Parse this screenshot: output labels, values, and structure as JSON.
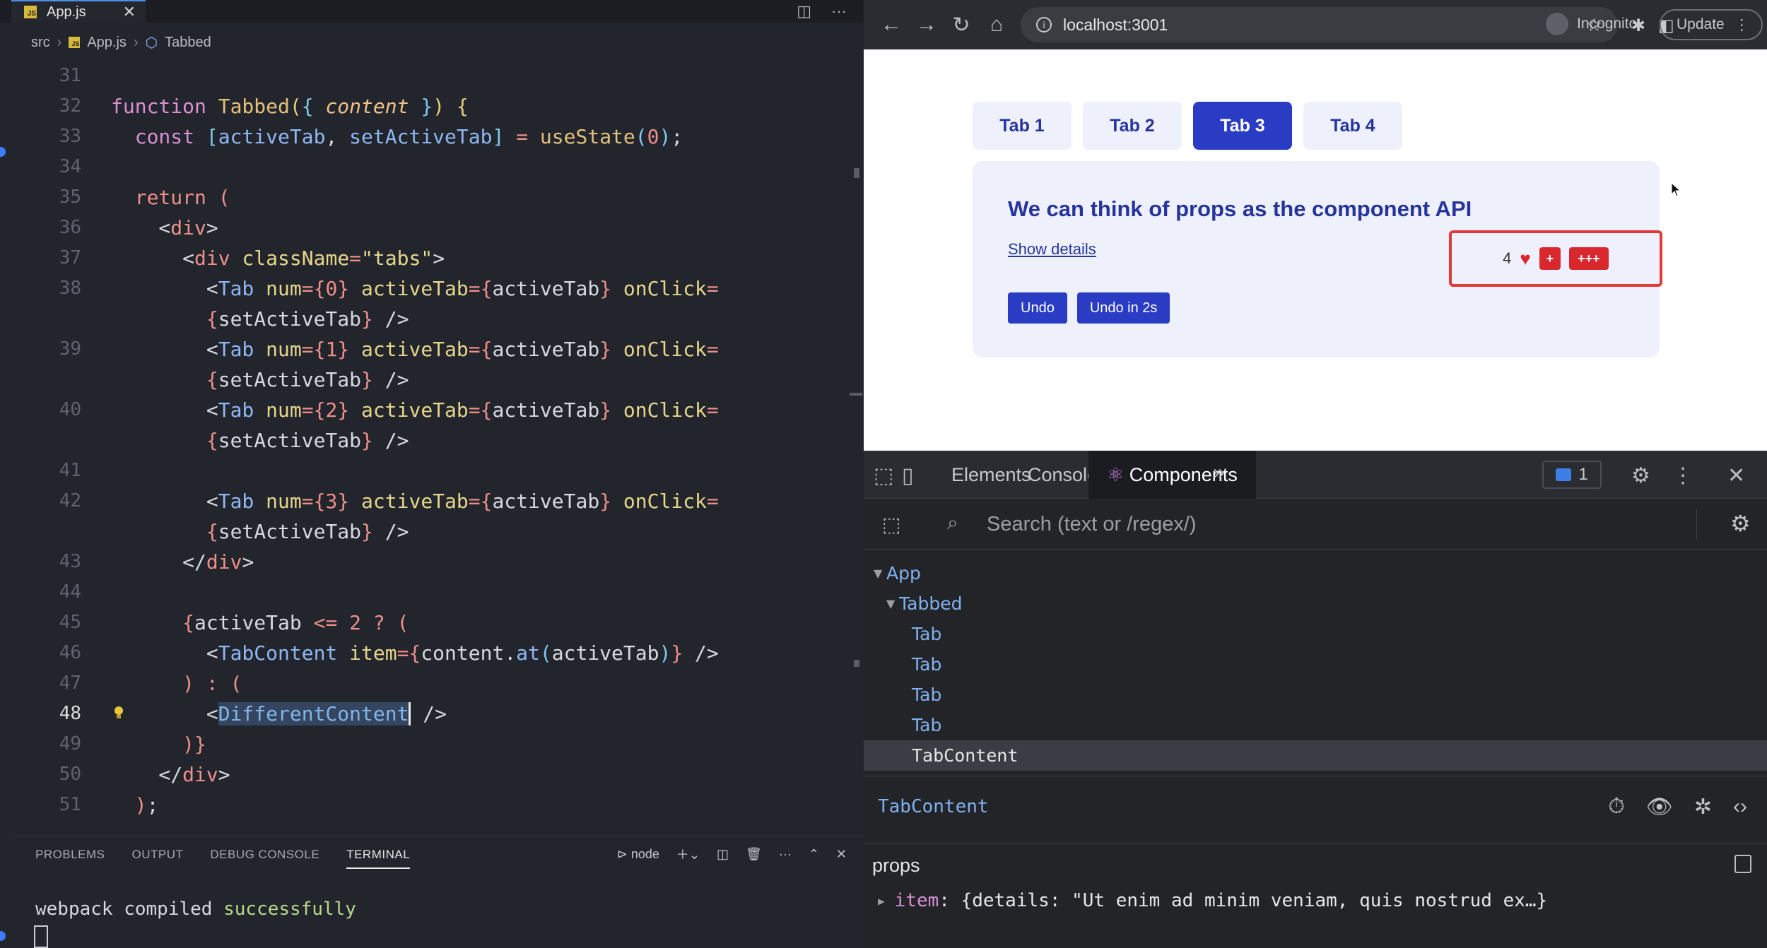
{
  "editor": {
    "tab": {
      "icon": "JS",
      "label": "App.js",
      "close": "✕"
    },
    "tab_actions": {
      "split": "◫",
      "more": "···"
    },
    "breadcrumb": {
      "folder": "src",
      "file": "App.js",
      "symbol": "Tabbed"
    },
    "lines": [
      {
        "n": "31",
        "html": ""
      },
      {
        "n": "32",
        "html": "<span class=\"k\">function</span> <span class=\"fn\">Tabbed</span><span class=\"br\">(</span><span class=\"cm\">{</span> <span class=\"it\">content</span> <span class=\"cm\">}</span><span class=\"br\">)</span> <span class=\"br\">{</span>"
      },
      {
        "n": "33",
        "html": "  <span class=\"k\">const</span> <span class=\"cm\">[</span><span class=\"tag\">activeTab</span>, <span class=\"tag\">setActiveTab</span><span class=\"cm\">]</span> <span class=\"kw\">=</span> <span class=\"fn\">useState</span><span class=\"cm\">(</span><span class=\"num\">0</span><span class=\"cm\">)</span>;"
      },
      {
        "n": "34",
        "html": ""
      },
      {
        "n": "35",
        "html": "  <span class=\"kw\">return</span> <span class=\"kw\">(</span>"
      },
      {
        "n": "36",
        "html": "    &lt;<span class=\"kw\">div</span>&gt;"
      },
      {
        "n": "37",
        "html": "      &lt;<span class=\"kw\">div</span> <span class=\"attr\">className</span><span class=\"kw\">=</span><span class=\"str\">\"tabs\"</span>&gt;"
      },
      {
        "n": "38",
        "html": "        &lt;<span class=\"tag\">Tab</span> <span class=\"attr\">num</span><span class=\"kw\">=</span><span class=\"kw\">{</span><span class=\"num\">0</span><span class=\"kw\">}</span> <span class=\"attr\">activeTab</span><span class=\"kw\">=</span><span class=\"kw\">{</span>activeTab<span class=\"kw\">}</span> <span class=\"attr\">onClick</span><span class=\"kw\">=</span>"
      },
      {
        "n": "",
        "html": "        <span class=\"kw\">{</span>setActiveTab<span class=\"kw\">}</span> /&gt;"
      },
      {
        "n": "39",
        "html": "        &lt;<span class=\"tag\">Tab</span> <span class=\"attr\">num</span><span class=\"kw\">=</span><span class=\"kw\">{</span><span class=\"num\">1</span><span class=\"kw\">}</span> <span class=\"attr\">activeTab</span><span class=\"kw\">=</span><span class=\"kw\">{</span>activeTab<span class=\"kw\">}</span> <span class=\"attr\">onClick</span><span class=\"kw\">=</span>"
      },
      {
        "n": "",
        "html": "        <span class=\"kw\">{</span>setActiveTab<span class=\"kw\">}</span> /&gt;"
      },
      {
        "n": "40",
        "html": "        &lt;<span class=\"tag\">Tab</span> <span class=\"attr\">num</span><span class=\"kw\">=</span><span class=\"kw\">{</span><span class=\"num\">2</span><span class=\"kw\">}</span> <span class=\"attr\">activeTab</span><span class=\"kw\">=</span><span class=\"kw\">{</span>activeTab<span class=\"kw\">}</span> <span class=\"attr\">onClick</span><span class=\"kw\">=</span>"
      },
      {
        "n": "",
        "html": "        <span class=\"kw\">{</span>setActiveTab<span class=\"kw\">}</span> /&gt;"
      },
      {
        "n": "41",
        "html": ""
      },
      {
        "n": "42",
        "html": "        &lt;<span class=\"tag\">Tab</span> <span class=\"attr\">num</span><span class=\"kw\">=</span><span class=\"kw\">{</span><span class=\"num\">3</span><span class=\"kw\">}</span> <span class=\"attr\">activeTab</span><span class=\"kw\">=</span><span class=\"kw\">{</span>activeTab<span class=\"kw\">}</span> <span class=\"attr\">onClick</span><span class=\"kw\">=</span>"
      },
      {
        "n": "",
        "html": "        <span class=\"kw\">{</span>setActiveTab<span class=\"kw\">}</span> /&gt;"
      },
      {
        "n": "43",
        "html": "      &lt;/<span class=\"kw\">div</span>&gt;"
      },
      {
        "n": "44",
        "html": ""
      },
      {
        "n": "45",
        "html": "      <span class=\"kw\">{</span>activeTab <span class=\"kw\">&lt;=</span> <span class=\"num\">2</span> <span class=\"kw\">?</span> <span class=\"kw\">(</span>"
      },
      {
        "n": "46",
        "html": "        &lt;<span class=\"tag\">TabContent</span> <span class=\"attr\">item</span><span class=\"kw\">=</span><span class=\"kw\">{</span>content.<span class=\"tag\">at</span><span class=\"cm\">(</span>activeTab<span class=\"cm\">)</span><span class=\"kw\">}</span> /&gt;"
      },
      {
        "n": "47",
        "html": "      <span class=\"kw\">)</span> <span class=\"kw\">:</span> <span class=\"kw\">(</span>"
      },
      {
        "n": "48",
        "html": "        &lt;<span class=\"sel\">DifferentContent</span> /&gt;"
      },
      {
        "n": "49",
        "html": "      <span class=\"kw\">)</span><span class=\"kw\">}</span>"
      },
      {
        "n": "50",
        "html": "    &lt;/<span class=\"kw\">div</span>&gt;"
      },
      {
        "n": "51",
        "html": "  <span class=\"kw\">)</span>;"
      }
    ],
    "active_line": "48",
    "panel_tabs": [
      "PROBLEMS",
      "OUTPUT",
      "DEBUG CONSOLE",
      "TERMINAL"
    ],
    "terminal_shell": "node",
    "terminal_text": "webpack compiled ",
    "terminal_status": "successfully"
  },
  "browser": {
    "url": "localhost:3001",
    "profile": "Incognito",
    "update_label": "Update",
    "app_tabs": [
      "Tab 1",
      "Tab 2",
      "Tab 3",
      "Tab 4"
    ],
    "active_tab_index": 2,
    "card_title": "We can think of props as the component API",
    "show_details": "Show details",
    "likes_count": "4",
    "plus_label": "+",
    "plus3_label": "+++",
    "undo_label": "Undo",
    "undo2s_label": "Undo in 2s"
  },
  "devtools": {
    "tabs": [
      "Elements",
      "Console",
      "Components"
    ],
    "more": "»",
    "message_count": "1",
    "search_placeholder": "Search (text or /regex/)",
    "tree": [
      {
        "label": "App",
        "depth": 0,
        "expanded": true
      },
      {
        "label": "Tabbed",
        "depth": 1,
        "expanded": true
      },
      {
        "label": "Tab",
        "depth": 2
      },
      {
        "label": "Tab",
        "depth": 2
      },
      {
        "label": "Tab",
        "depth": 2
      },
      {
        "label": "Tab",
        "depth": 2
      },
      {
        "label": "TabContent",
        "depth": 2,
        "selected": true
      }
    ],
    "selected_component": "TabContent",
    "props_label": "props",
    "prop_key": "item",
    "prop_value": ": {details: \"Ut enim ad minim veniam, quis nostrud ex…}"
  },
  "colors": {
    "accent_blue": "#2a3bc4",
    "highlight_red": "#e23b36",
    "editor_bg": "#22252c",
    "devtools_bg": "#222428"
  }
}
